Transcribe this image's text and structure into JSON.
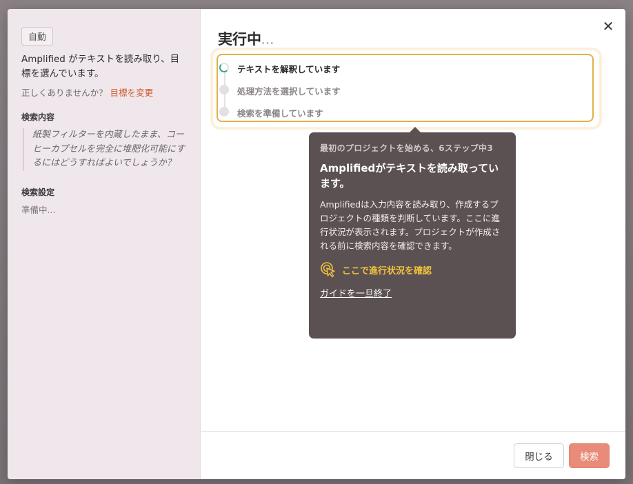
{
  "left": {
    "mode_badge": "自動",
    "reading_text": "Amplified がテキストを読み取り、目標を選んでいます。",
    "wrong_prompt": "正しくありませんか？",
    "change_goal_link": "目標を変更",
    "query_title": "検索内容",
    "query_text": "紙製フィルターを内蔵したまま、コーヒーカプセルを完全に堆肥化可能にするにはどうすればよいでしょうか？",
    "settings_title": "検索設定",
    "settings_value": "準備中..."
  },
  "main": {
    "title": "実行中",
    "title_dots": "...",
    "steps": [
      {
        "label": "テキストを解釈しています",
        "state": "active"
      },
      {
        "label": "処理方法を選択しています",
        "state": "pending"
      },
      {
        "label": "検索を準備しています",
        "state": "pending"
      }
    ]
  },
  "tooltip": {
    "step_text": "最初のプロジェクトを始める、6ステップ中3",
    "heading": "Amplifiedがテキストを読み取っています。",
    "body": "Amplifiedは入力内容を読み取り、作成するプロジェクトの種類を判断しています。ここに進行状況が表示されます。プロジェクトが作成される前に検索内容を確認できます。",
    "action_label": "ここで進行状況を確認",
    "action_icon": "pointer-click-icon",
    "exit_label": "ガイドを一旦終了"
  },
  "footer": {
    "close_label": "閉じる",
    "search_label": "検索"
  },
  "colors": {
    "accent_link": "#d0562d",
    "highlight_border": "#e2b247",
    "tooltip_bg": "#5b5153",
    "tooltip_action": "#f2c23c",
    "search_button": "#e88b78",
    "spinner": "#3aa88e"
  }
}
